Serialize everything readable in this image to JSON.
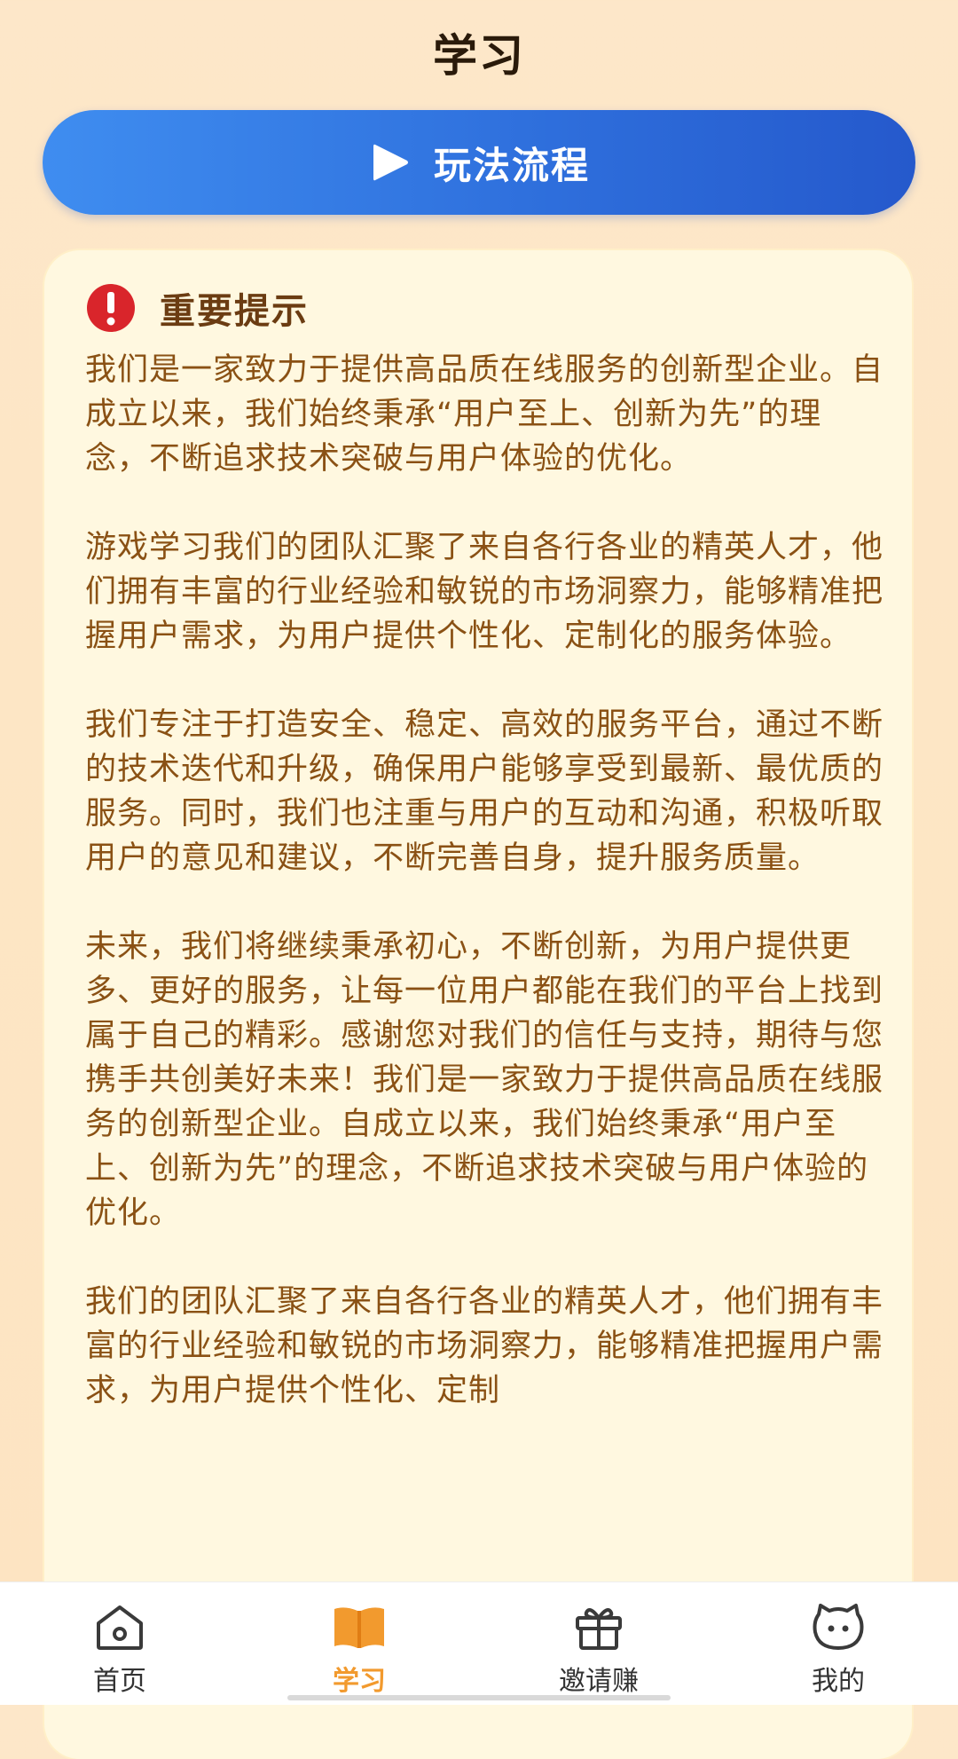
{
  "header": {
    "title": "学习"
  },
  "flow_button": {
    "label": "玩法流程",
    "icon": "play-icon"
  },
  "notice": {
    "icon": "exclamation-icon",
    "title": "重要提示",
    "paragraphs": [
      "我们是一家致力于提供高品质在线服务的创新型企业。自成立以来，我们始终秉承“用户至上、创新为先”的理念，不断追求技术突破与用户体验的优化。",
      "游戏学习我们的团队汇聚了来自各行各业的精英人才，他们拥有丰富的行业经验和敏锐的市场洞察力，能够精准把握用户需求，为用户提供个性化、定制化的服务体验。",
      "我们专注于打造安全、稳定、高效的服务平台，通过不断的技术迭代和升级，确保用户能够享受到最新、最优质的服务。同时，我们也注重与用户的互动和沟通，积极听取用户的意见和建议，不断完善自身，提升服务质量。",
      "未来，我们将继续秉承初心，不断创新，为用户提供更多、更好的服务，让每一位用户都能在我们的平台上找到属于自己的精彩。感谢您对我们的信任与支持，期待与您携手共创美好未来！我们是一家致力于提供高品质在线服务的创新型企业。自成立以来，我们始终秉承“用户至上、创新为先”的理念，不断追求技术突破与用户体验的优化。",
      "我们的团队汇聚了来自各行各业的精英人才，他们拥有丰富的行业经验和敏锐的市场洞察力，能够精准把握用户需求，为用户提供个性化、定制"
    ]
  },
  "tabbar": {
    "items": [
      {
        "label": "首页",
        "icon": "home-icon",
        "active": false
      },
      {
        "label": "学习",
        "icon": "book-icon",
        "active": true
      },
      {
        "label": "邀请赚",
        "icon": "gift-icon",
        "active": false
      },
      {
        "label": "我的",
        "icon": "face-icon",
        "active": false
      }
    ]
  },
  "colors": {
    "accent": "#f29a2e",
    "button_blue": "#2f70dd",
    "notice_text": "#8a5114",
    "alert_red": "#d9252b"
  }
}
